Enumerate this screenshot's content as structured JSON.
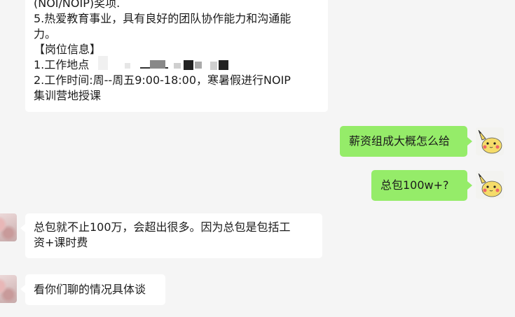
{
  "messages": [
    {
      "lines": [
        "(NOI/NOIP)奖项.",
        "5.热爱教育事业，具有良好的团队协作能力和沟通能",
        "力。",
        "【岗位信息】",
        "1.工作地点",
        "2.工作时间:周--周五9:00-18:00，寒暑假进行NOIP",
        "集训营地授课"
      ]
    },
    {
      "text": "薪资组成大概怎么给"
    },
    {
      "text": "总包100w+?"
    },
    {
      "lines": [
        "总包就不止100万，会超出很多。因为总包是包括工",
        "资+课时费"
      ]
    },
    {
      "text": "看你们聊的情况具体谈"
    }
  ],
  "avatars": {
    "self": "pikachu-avatar",
    "other": "photo-avatar"
  },
  "colors": {
    "outgoing_bubble": "#95ec69",
    "incoming_bubble": "#ffffff",
    "background": "#f5f5f5"
  }
}
